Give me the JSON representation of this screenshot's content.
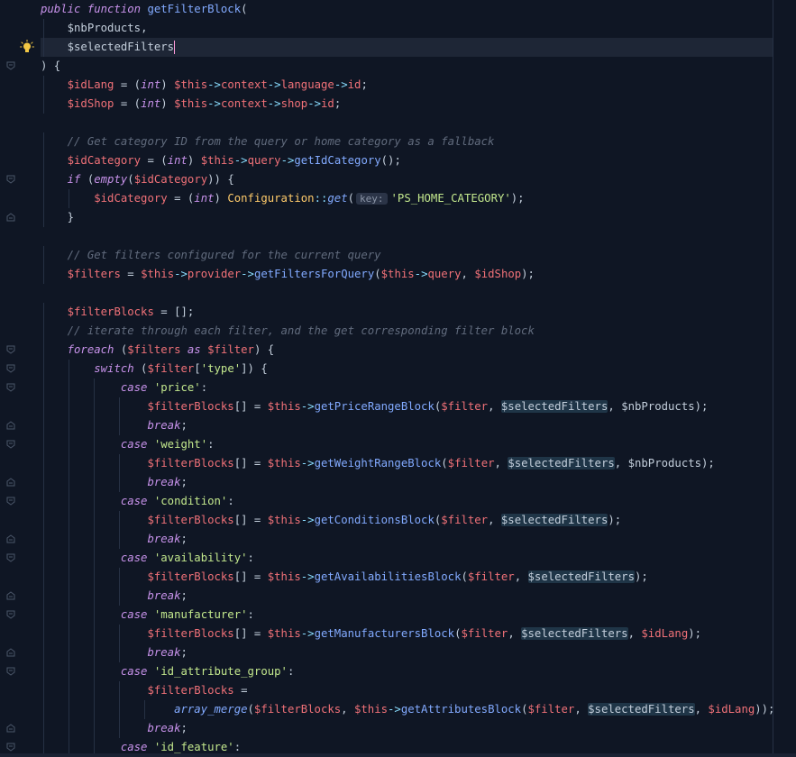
{
  "editor": {
    "language": "php",
    "hint_label": "key:",
    "lines": [
      [
        [
          "kw",
          "public function "
        ],
        [
          "fn",
          "getFilterBlock"
        ],
        [
          "punc",
          "("
        ]
      ],
      [
        [
          "ws",
          "    "
        ],
        [
          "plain-var",
          "$nbProducts"
        ],
        [
          "punc",
          ","
        ]
      ],
      [
        [
          "ws",
          "    "
        ],
        [
          "plain-var",
          "$selectedFilters"
        ]
      ],
      [
        [
          "punc",
          ") {"
        ]
      ],
      [
        [
          "ws",
          "    "
        ],
        [
          "var",
          "$idLang"
        ],
        [
          "punc",
          " = ("
        ],
        [
          "kw",
          "int"
        ],
        [
          "punc",
          ") "
        ],
        [
          "var",
          "$this"
        ],
        [
          "op",
          "->"
        ],
        [
          "var",
          "context"
        ],
        [
          "op",
          "->"
        ],
        [
          "var",
          "language"
        ],
        [
          "op",
          "->"
        ],
        [
          "var",
          "id"
        ],
        [
          "punc",
          ";"
        ]
      ],
      [
        [
          "ws",
          "    "
        ],
        [
          "var",
          "$idShop"
        ],
        [
          "punc",
          " = ("
        ],
        [
          "kw",
          "int"
        ],
        [
          "punc",
          ") "
        ],
        [
          "var",
          "$this"
        ],
        [
          "op",
          "->"
        ],
        [
          "var",
          "context"
        ],
        [
          "op",
          "->"
        ],
        [
          "var",
          "shop"
        ],
        [
          "op",
          "->"
        ],
        [
          "var",
          "id"
        ],
        [
          "punc",
          ";"
        ]
      ],
      [],
      [
        [
          "ws",
          "    "
        ],
        [
          "cmt",
          "// Get category ID from the query or home category as a fallback"
        ]
      ],
      [
        [
          "ws",
          "    "
        ],
        [
          "var",
          "$idCategory"
        ],
        [
          "punc",
          " = ("
        ],
        [
          "kw",
          "int"
        ],
        [
          "punc",
          ") "
        ],
        [
          "var",
          "$this"
        ],
        [
          "op",
          "->"
        ],
        [
          "var",
          "query"
        ],
        [
          "op",
          "->"
        ],
        [
          "fn",
          "getIdCategory"
        ],
        [
          "punc",
          "();"
        ]
      ],
      [
        [
          "ws",
          "    "
        ],
        [
          "kw",
          "if"
        ],
        [
          "punc",
          " ("
        ],
        [
          "kw",
          "empty"
        ],
        [
          "punc",
          "("
        ],
        [
          "var",
          "$idCategory"
        ],
        [
          "punc",
          ")) {"
        ]
      ],
      [
        [
          "ws",
          "        "
        ],
        [
          "var",
          "$idCategory"
        ],
        [
          "punc",
          " = ("
        ],
        [
          "kw",
          "int"
        ],
        [
          "punc",
          ") "
        ],
        [
          "cls",
          "Configuration"
        ],
        [
          "op",
          "::"
        ],
        [
          "fnitalic",
          "get"
        ],
        [
          "punc",
          "("
        ],
        [
          "hint",
          "key:"
        ],
        [
          "str",
          "'PS_HOME_CATEGORY'"
        ],
        [
          "punc",
          ");"
        ]
      ],
      [
        [
          "ws",
          "    "
        ],
        [
          "punc",
          "}"
        ]
      ],
      [],
      [
        [
          "ws",
          "    "
        ],
        [
          "cmt",
          "// Get filters configured for the current query"
        ]
      ],
      [
        [
          "ws",
          "    "
        ],
        [
          "var",
          "$filters"
        ],
        [
          "punc",
          " = "
        ],
        [
          "var",
          "$this"
        ],
        [
          "op",
          "->"
        ],
        [
          "var",
          "provider"
        ],
        [
          "op",
          "->"
        ],
        [
          "fn",
          "getFiltersForQuery"
        ],
        [
          "punc",
          "("
        ],
        [
          "var",
          "$this"
        ],
        [
          "op",
          "->"
        ],
        [
          "var",
          "query"
        ],
        [
          "punc",
          ", "
        ],
        [
          "var",
          "$idShop"
        ],
        [
          "punc",
          ");"
        ]
      ],
      [],
      [
        [
          "ws",
          "    "
        ],
        [
          "var",
          "$filterBlocks"
        ],
        [
          "punc",
          " = [];"
        ]
      ],
      [
        [
          "ws",
          "    "
        ],
        [
          "cmt",
          "// iterate through each filter, and the get corresponding filter block"
        ]
      ],
      [
        [
          "ws",
          "    "
        ],
        [
          "kw",
          "foreach"
        ],
        [
          "punc",
          " ("
        ],
        [
          "var",
          "$filters"
        ],
        [
          "kw",
          " as "
        ],
        [
          "var",
          "$filter"
        ],
        [
          "punc",
          ") {"
        ]
      ],
      [
        [
          "ws",
          "        "
        ],
        [
          "kw",
          "switch"
        ],
        [
          "punc",
          " ("
        ],
        [
          "var",
          "$filter"
        ],
        [
          "punc",
          "["
        ],
        [
          "str",
          "'type'"
        ],
        [
          "punc",
          "]) {"
        ]
      ],
      [
        [
          "ws",
          "            "
        ],
        [
          "kw",
          "case"
        ],
        [
          "punc",
          " "
        ],
        [
          "str",
          "'price'"
        ],
        [
          "punc",
          ":"
        ]
      ],
      [
        [
          "ws",
          "                "
        ],
        [
          "var",
          "$filterBlocks"
        ],
        [
          "punc",
          "[] = "
        ],
        [
          "var",
          "$this"
        ],
        [
          "op",
          "->"
        ],
        [
          "fn",
          "getPriceRangeBlock"
        ],
        [
          "punc",
          "("
        ],
        [
          "var",
          "$filter"
        ],
        [
          "punc",
          ", "
        ],
        [
          "hl",
          "$selectedFilters"
        ],
        [
          "punc",
          ", "
        ],
        [
          "plain-var",
          "$nbProducts"
        ],
        [
          "punc",
          ");"
        ]
      ],
      [
        [
          "ws",
          "                "
        ],
        [
          "kw",
          "break"
        ],
        [
          "punc",
          ";"
        ]
      ],
      [
        [
          "ws",
          "            "
        ],
        [
          "kw",
          "case"
        ],
        [
          "punc",
          " "
        ],
        [
          "str",
          "'weight'"
        ],
        [
          "punc",
          ":"
        ]
      ],
      [
        [
          "ws",
          "                "
        ],
        [
          "var",
          "$filterBlocks"
        ],
        [
          "punc",
          "[] = "
        ],
        [
          "var",
          "$this"
        ],
        [
          "op",
          "->"
        ],
        [
          "fn",
          "getWeightRangeBlock"
        ],
        [
          "punc",
          "("
        ],
        [
          "var",
          "$filter"
        ],
        [
          "punc",
          ", "
        ],
        [
          "hl",
          "$selectedFilters"
        ],
        [
          "punc",
          ", "
        ],
        [
          "plain-var",
          "$nbProducts"
        ],
        [
          "punc",
          ");"
        ]
      ],
      [
        [
          "ws",
          "                "
        ],
        [
          "kw",
          "break"
        ],
        [
          "punc",
          ";"
        ]
      ],
      [
        [
          "ws",
          "            "
        ],
        [
          "kw",
          "case"
        ],
        [
          "punc",
          " "
        ],
        [
          "str",
          "'condition'"
        ],
        [
          "punc",
          ":"
        ]
      ],
      [
        [
          "ws",
          "                "
        ],
        [
          "var",
          "$filterBlocks"
        ],
        [
          "punc",
          "[] = "
        ],
        [
          "var",
          "$this"
        ],
        [
          "op",
          "->"
        ],
        [
          "fn",
          "getConditionsBlock"
        ],
        [
          "punc",
          "("
        ],
        [
          "var",
          "$filter"
        ],
        [
          "punc",
          ", "
        ],
        [
          "hl",
          "$selectedFilters"
        ],
        [
          "punc",
          ");"
        ]
      ],
      [
        [
          "ws",
          "                "
        ],
        [
          "kw",
          "break"
        ],
        [
          "punc",
          ";"
        ]
      ],
      [
        [
          "ws",
          "            "
        ],
        [
          "kw",
          "case"
        ],
        [
          "punc",
          " "
        ],
        [
          "str",
          "'availability'"
        ],
        [
          "punc",
          ":"
        ]
      ],
      [
        [
          "ws",
          "                "
        ],
        [
          "var",
          "$filterBlocks"
        ],
        [
          "punc",
          "[] = "
        ],
        [
          "var",
          "$this"
        ],
        [
          "op",
          "->"
        ],
        [
          "fn",
          "getAvailabilitiesBlock"
        ],
        [
          "punc",
          "("
        ],
        [
          "var",
          "$filter"
        ],
        [
          "punc",
          ", "
        ],
        [
          "hl",
          "$selectedFilters"
        ],
        [
          "punc",
          ");"
        ]
      ],
      [
        [
          "ws",
          "                "
        ],
        [
          "kw",
          "break"
        ],
        [
          "punc",
          ";"
        ]
      ],
      [
        [
          "ws",
          "            "
        ],
        [
          "kw",
          "case"
        ],
        [
          "punc",
          " "
        ],
        [
          "str",
          "'manufacturer'"
        ],
        [
          "punc",
          ":"
        ]
      ],
      [
        [
          "ws",
          "                "
        ],
        [
          "var",
          "$filterBlocks"
        ],
        [
          "punc",
          "[] = "
        ],
        [
          "var",
          "$this"
        ],
        [
          "op",
          "->"
        ],
        [
          "fn",
          "getManufacturersBlock"
        ],
        [
          "punc",
          "("
        ],
        [
          "var",
          "$filter"
        ],
        [
          "punc",
          ", "
        ],
        [
          "hl",
          "$selectedFilters"
        ],
        [
          "punc",
          ", "
        ],
        [
          "var",
          "$idLang"
        ],
        [
          "punc",
          ");"
        ]
      ],
      [
        [
          "ws",
          "                "
        ],
        [
          "kw",
          "break"
        ],
        [
          "punc",
          ";"
        ]
      ],
      [
        [
          "ws",
          "            "
        ],
        [
          "kw",
          "case"
        ],
        [
          "punc",
          " "
        ],
        [
          "str",
          "'id_attribute_group'"
        ],
        [
          "punc",
          ":"
        ]
      ],
      [
        [
          "ws",
          "                "
        ],
        [
          "var",
          "$filterBlocks"
        ],
        [
          "punc",
          " ="
        ]
      ],
      [
        [
          "ws",
          "                    "
        ],
        [
          "fnitalic",
          "array_merge"
        ],
        [
          "punc",
          "("
        ],
        [
          "var",
          "$filterBlocks"
        ],
        [
          "punc",
          ", "
        ],
        [
          "var",
          "$this"
        ],
        [
          "op",
          "->"
        ],
        [
          "fn",
          "getAttributesBlock"
        ],
        [
          "punc",
          "("
        ],
        [
          "var",
          "$filter"
        ],
        [
          "punc",
          ", "
        ],
        [
          "hl",
          "$selectedFilters"
        ],
        [
          "punc",
          ", "
        ],
        [
          "var",
          "$idLang"
        ],
        [
          "punc",
          "));"
        ]
      ],
      [
        [
          "ws",
          "                "
        ],
        [
          "kw",
          "break"
        ],
        [
          "punc",
          ";"
        ]
      ],
      [
        [
          "ws",
          "            "
        ],
        [
          "kw",
          "case"
        ],
        [
          "punc",
          " "
        ],
        [
          "str",
          "'id_feature'"
        ],
        [
          "punc",
          ":"
        ]
      ]
    ]
  }
}
